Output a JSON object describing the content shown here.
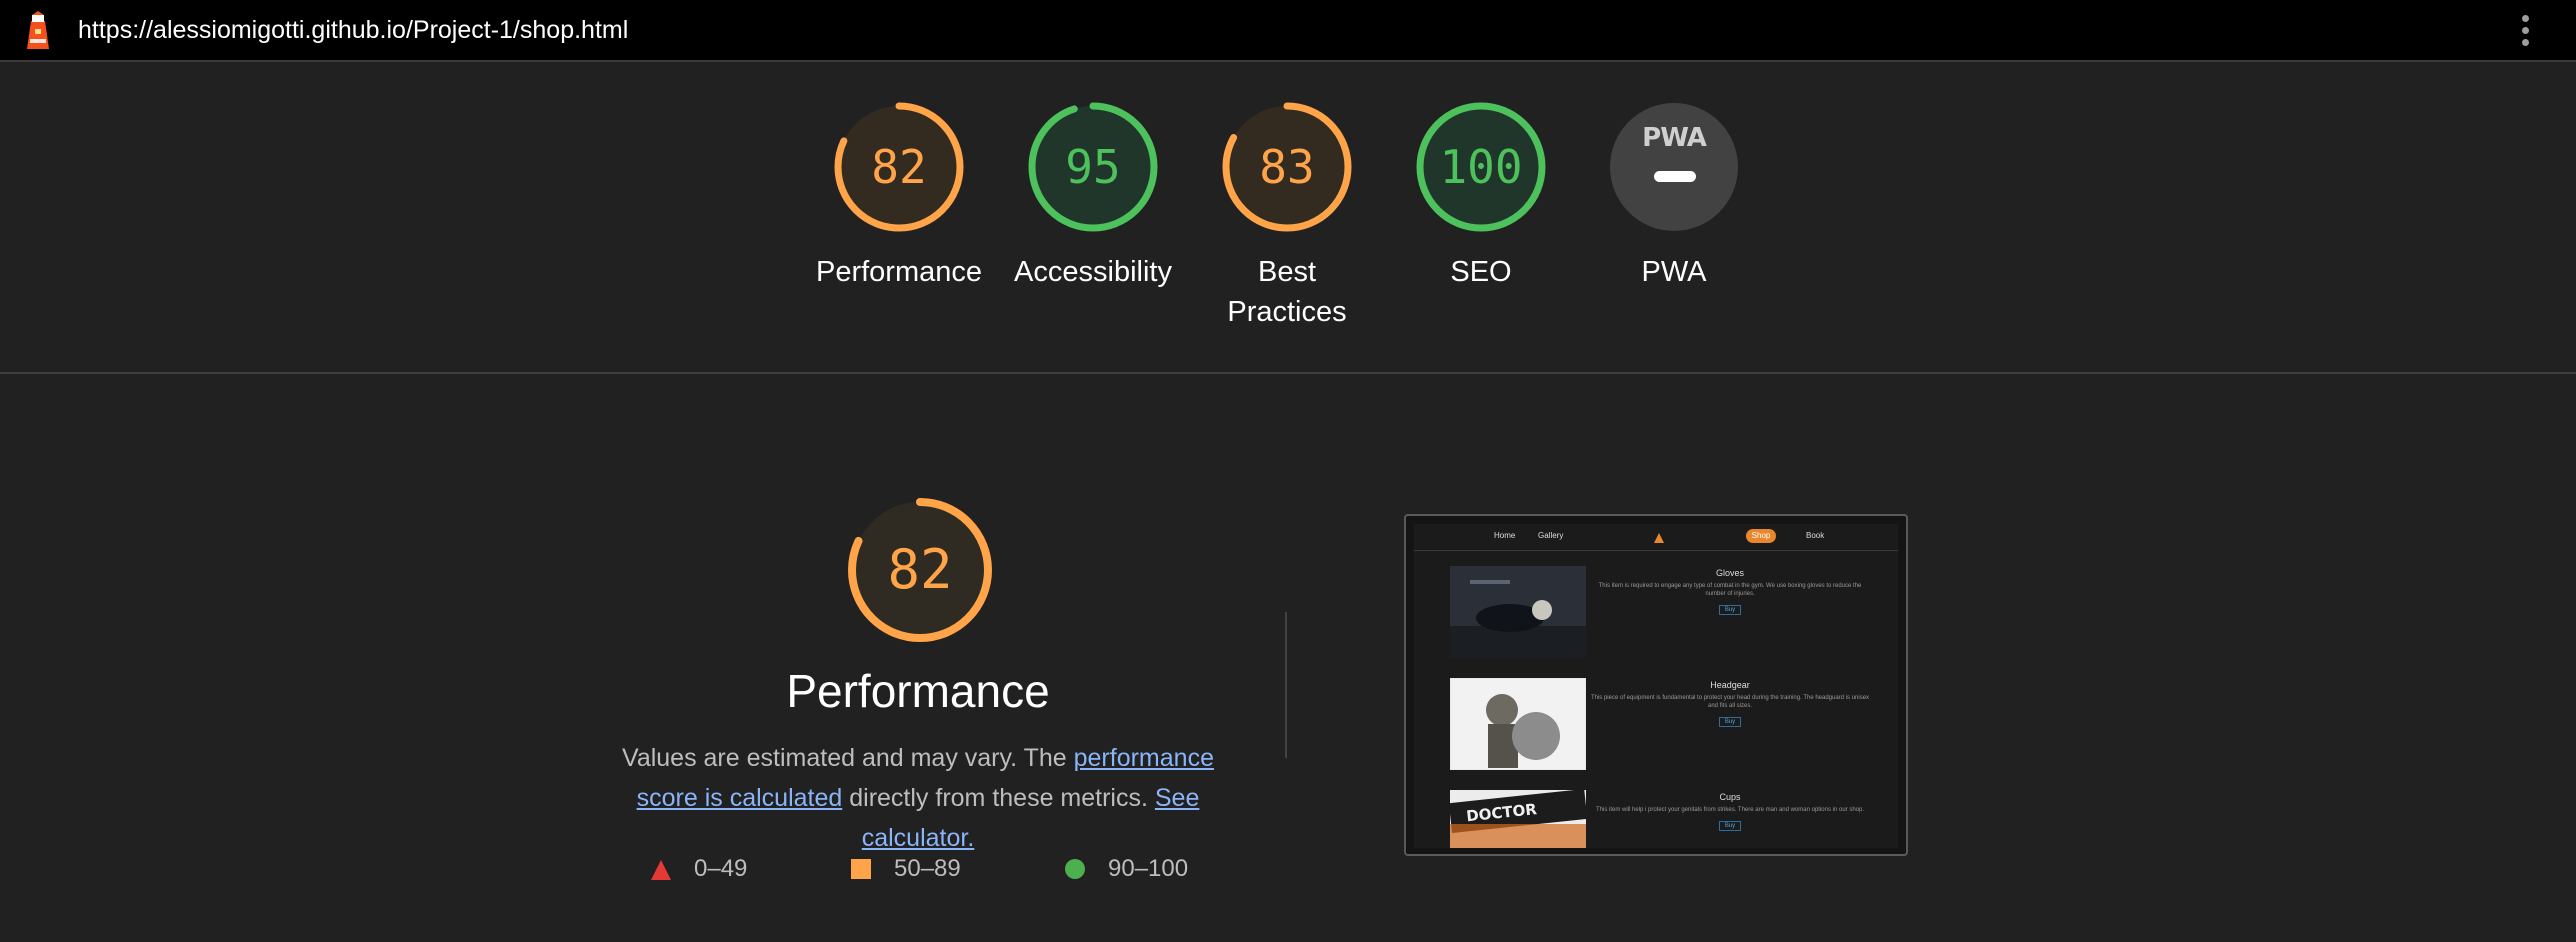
{
  "header": {
    "url": "https://alessiomigotti.github.io/Project-1/shop.html",
    "logo_icon": "lighthouse-icon",
    "menu_icon": "kebab-menu-icon"
  },
  "scores": [
    {
      "value": 82,
      "label": "Performance",
      "status": "average"
    },
    {
      "value": 95,
      "label": "Accessibility",
      "status": "pass"
    },
    {
      "value": 83,
      "label": "Best Practices",
      "status": "average"
    },
    {
      "value": 100,
      "label": "SEO",
      "status": "pass"
    }
  ],
  "pwa": {
    "badge": "PWA",
    "label": "PWA"
  },
  "performance": {
    "score": 82,
    "title": "Performance",
    "desc_prefix": "Values are estimated and may vary. The",
    "link_text": "performance score is calculated",
    "desc_middle": "directly from these metrics.",
    "calc_link": "See calculator."
  },
  "legend": [
    {
      "range": "0–49",
      "shape": "triangle",
      "color": "#e53935"
    },
    {
      "range": "50–89",
      "shape": "square",
      "color": "#ffa449"
    },
    {
      "range": "90–100",
      "shape": "circle",
      "color": "#4caf50"
    }
  ],
  "colors": {
    "average": "#ffa449",
    "pass": "#4dc15c",
    "fail": "#e53935",
    "background": "#212121"
  },
  "screenshot": {
    "nav": [
      "Home",
      "Gallery",
      "Shop",
      "Book"
    ],
    "items": [
      {
        "title": "Gloves",
        "text": "This item is required to engage any type of combat in the gym. We use boxing gloves to reduce the number of injuries.",
        "button": "Buy"
      },
      {
        "title": "Headgear",
        "text": "This piece of equipment is fundamental to protect your head during the training. The headguard is unisex and fits all sizes.",
        "button": "Buy"
      },
      {
        "title": "Cups",
        "text": "This item will help i protect your genitals from strikes. There are man and woman options in our shop.",
        "button": "Buy"
      }
    ]
  }
}
